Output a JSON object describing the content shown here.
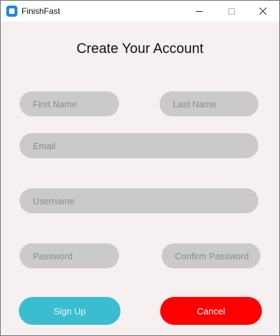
{
  "window": {
    "title": "FinishFast",
    "controls": {
      "minimize_icon": "minimize-icon",
      "maximize_icon": "maximize-icon",
      "close_icon": "close-icon"
    }
  },
  "form": {
    "heading": "Create Your Account",
    "fields": {
      "first_name": {
        "placeholder": "First Name",
        "value": ""
      },
      "last_name": {
        "placeholder": "Last Name",
        "value": ""
      },
      "email": {
        "placeholder": "Email",
        "value": ""
      },
      "username": {
        "placeholder": "Username",
        "value": ""
      },
      "password": {
        "placeholder": "Password",
        "value": ""
      },
      "confirm_password": {
        "placeholder": "Confirm Password",
        "value": ""
      }
    },
    "buttons": {
      "sign_up": "Sign Up",
      "cancel": "Cancel"
    }
  },
  "colors": {
    "background": "#f7f0f0",
    "field": "#cccac8",
    "sign_up": "#3bbdd0",
    "cancel": "#ff0000"
  }
}
